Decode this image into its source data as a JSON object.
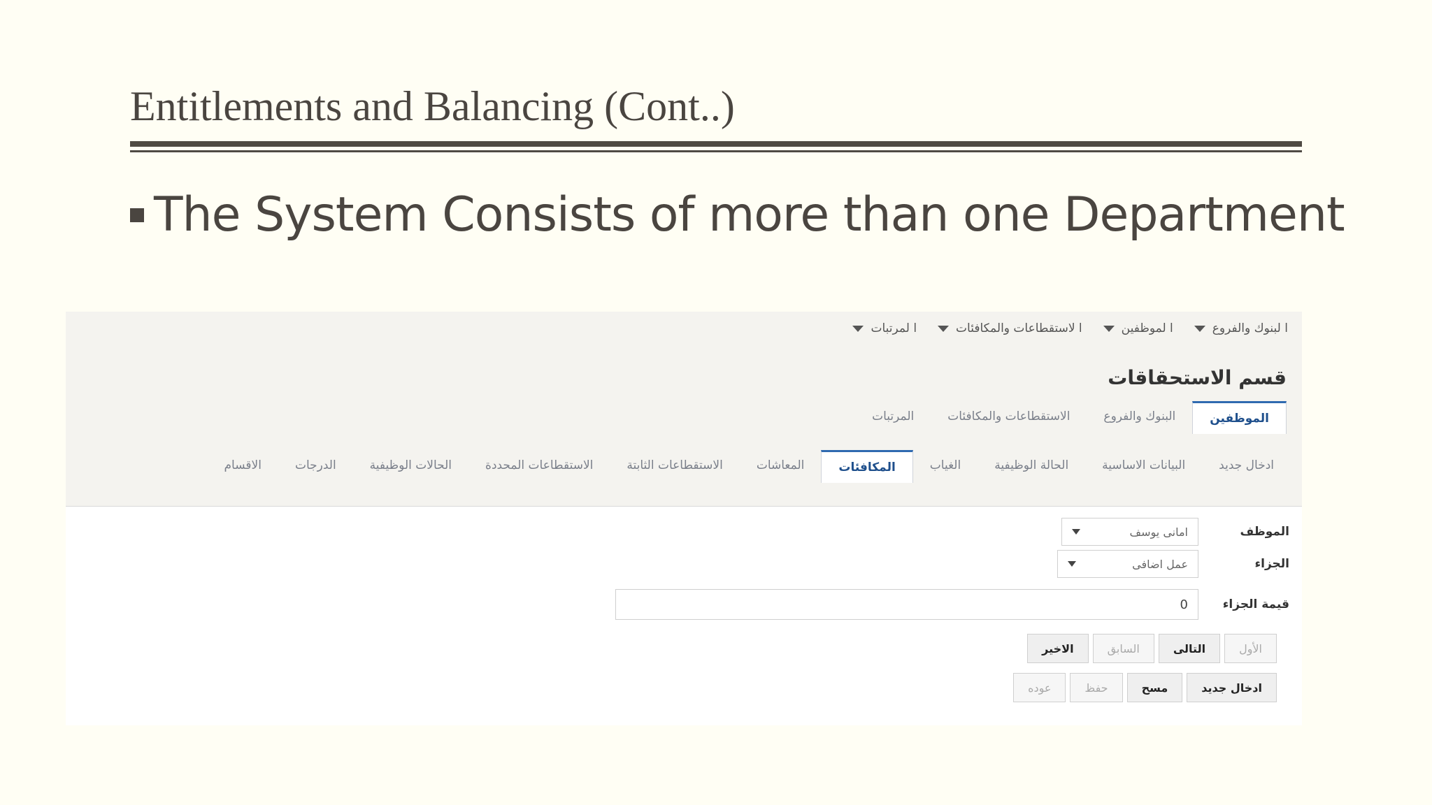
{
  "slide": {
    "title": "Entitlements and Balancing (Cont..)",
    "bullet": "The System Consists of more than one Department"
  },
  "app": {
    "top_menu": [
      {
        "label": "ا لبنوك والفروع"
      },
      {
        "label": "ا لموظفين"
      },
      {
        "label": "ا لاستقطاعات والمكافئات"
      },
      {
        "label": "ا لمرتبات"
      }
    ],
    "page_heading": "قسم الاستحقاقات",
    "primary_tabs": [
      {
        "label": "الموظفين",
        "active": true
      },
      {
        "label": "البنوك والفروع",
        "active": false
      },
      {
        "label": "الاستقطاعات والمكافئات",
        "active": false
      },
      {
        "label": "المرتبات",
        "active": false
      }
    ],
    "secondary_tabs": [
      {
        "label": "ادخال جديد",
        "active": false
      },
      {
        "label": "البيانات الاساسية",
        "active": false
      },
      {
        "label": "الحالة الوظيفية",
        "active": false
      },
      {
        "label": "الغياب",
        "active": false
      },
      {
        "label": "المكافئات",
        "active": true
      },
      {
        "label": "المعاشات",
        "active": false
      },
      {
        "label": "الاستقطاعات الثابتة",
        "active": false
      },
      {
        "label": "الاستقطاعات المحددة",
        "active": false
      },
      {
        "label": "الحالات الوظيفية",
        "active": false
      },
      {
        "label": "الدرجات",
        "active": false
      },
      {
        "label": "الاقسام",
        "active": false
      }
    ],
    "form": {
      "employee_label": "الموظف",
      "employee_value": "امانى يوسف",
      "part_label": "الجزاء",
      "part_value": "عمل اضافى",
      "part_value_label": "قيمة الجزاء",
      "part_value_amount": "0"
    },
    "nav_buttons": {
      "first": "الأول",
      "next": "التالى",
      "previous": "السابق",
      "last": "الاخير"
    },
    "action_buttons": {
      "new_entry": "ادخال جديد",
      "delete": "مسح",
      "save": "حفظ",
      "back": "عوده"
    }
  }
}
